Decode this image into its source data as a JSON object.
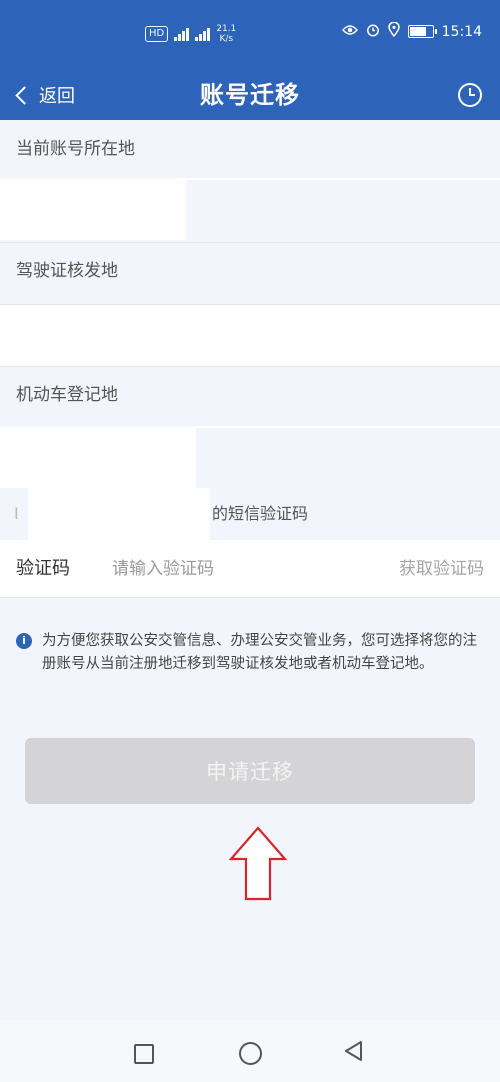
{
  "status_bar": {
    "hd_badge": "HD",
    "net_speed_top": "21.1",
    "net_speed_bottom": "K/s",
    "time": "15:14"
  },
  "nav": {
    "back_label": "返回",
    "title": "账号迁移"
  },
  "fields": {
    "current_location_label": "当前账号所在地",
    "license_issue_label": "驾驶证核发地",
    "vehicle_registration_label": "机动车登记地"
  },
  "sms": {
    "prefix": "I",
    "hint_suffix": "的短信验证码"
  },
  "verification": {
    "label": "验证码",
    "placeholder": "请输入验证码",
    "get_code": "获取验证码"
  },
  "info": {
    "text": "为方便您获取公安交管信息、办理公安交管业务，您可选择将您的注册账号从当前注册地迁移到驾驶证核发地或者机动车登记地。"
  },
  "apply_button": {
    "label": "申请迁移"
  },
  "colors": {
    "brand": "#2d63b8",
    "disabled_button": "#d4d4d6",
    "annotation_arrow": "#d9262b"
  }
}
